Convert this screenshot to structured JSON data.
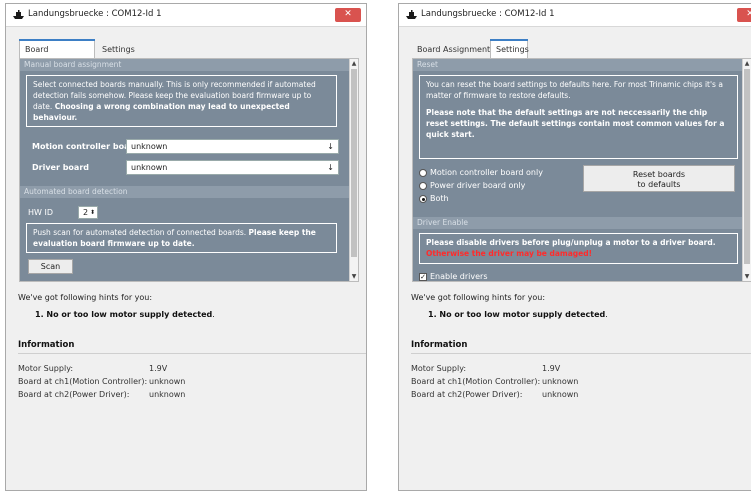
{
  "left_window": {
    "title": "Landungsbruecke : COM12-Id 1",
    "close_icon": "close-x-icon",
    "tabs": [
      {
        "label": "Board Assignment",
        "active": true
      },
      {
        "label": "Settings",
        "active": false
      }
    ],
    "manual": {
      "header": "Manual board assignment",
      "info_text": "Select connected boards manually. This is only recommended if automated detection fails somehow. Please keep the evaluation board firmware up to date.",
      "info_bold": "Choosing a wrong combination may lead to unexpected behaviour.",
      "motion_label": "Motion controller board",
      "motion_value": "unknown",
      "driver_label": "Driver board",
      "driver_value": "unknown"
    },
    "auto": {
      "header": "Automated board detection",
      "hwid_label": "HW ID",
      "hwid_value": "2",
      "info_text": "Push scan for automated detection of connected boards.",
      "info_bold": "Please keep the evaluation board firmware up to date.",
      "scan_label": "Scan"
    }
  },
  "right_window": {
    "title": "Landungsbruecke : COM12-Id 1",
    "tabs": [
      {
        "label": "Board Assignment",
        "active": false
      },
      {
        "label": "Settings",
        "active": true
      }
    ],
    "reset": {
      "header": "Reset",
      "info_text": "You can reset the board settings to defaults here. For most Trinamic chips it's a matter of firmware to restore defaults.",
      "info_bold": "Please note that the default settings are not neccessarily the chip reset settings. The default settings contain most common values for a quick start.",
      "options": [
        {
          "label": "Motion controller board only",
          "selected": false
        },
        {
          "label": "Power driver board only",
          "selected": false
        },
        {
          "label": "Both",
          "selected": true
        }
      ],
      "button_line1": "Reset boards",
      "button_line2": "to defaults"
    },
    "driver_enable": {
      "header": "Driver Enable",
      "warn_text": "Please disable drivers before plug/unplug a motor to a driver board.",
      "warn_red": "Otherwise the driver may be damaged!",
      "checkbox_label": "Enable drivers",
      "checked": true
    }
  },
  "common": {
    "hints_intro": "We've got following hints for you:",
    "hint_1": "1. No or too low motor supply detected",
    "hint_1_suffix": ".",
    "info_header": "Information",
    "rows": [
      {
        "key": "Motor Supply:",
        "value": "1.9V"
      },
      {
        "key": "Board at ch1(Motion Controller):",
        "value": "unknown"
      },
      {
        "key": "Board at ch2(Power Driver):",
        "value": "unknown"
      }
    ]
  },
  "colors": {
    "panel_bg": "#7b8a99",
    "group_header_bg": "#8e9caa",
    "close_button": "#d9534f",
    "tab_accent": "#3d7fc5",
    "warning_red": "#ff2b2b"
  }
}
